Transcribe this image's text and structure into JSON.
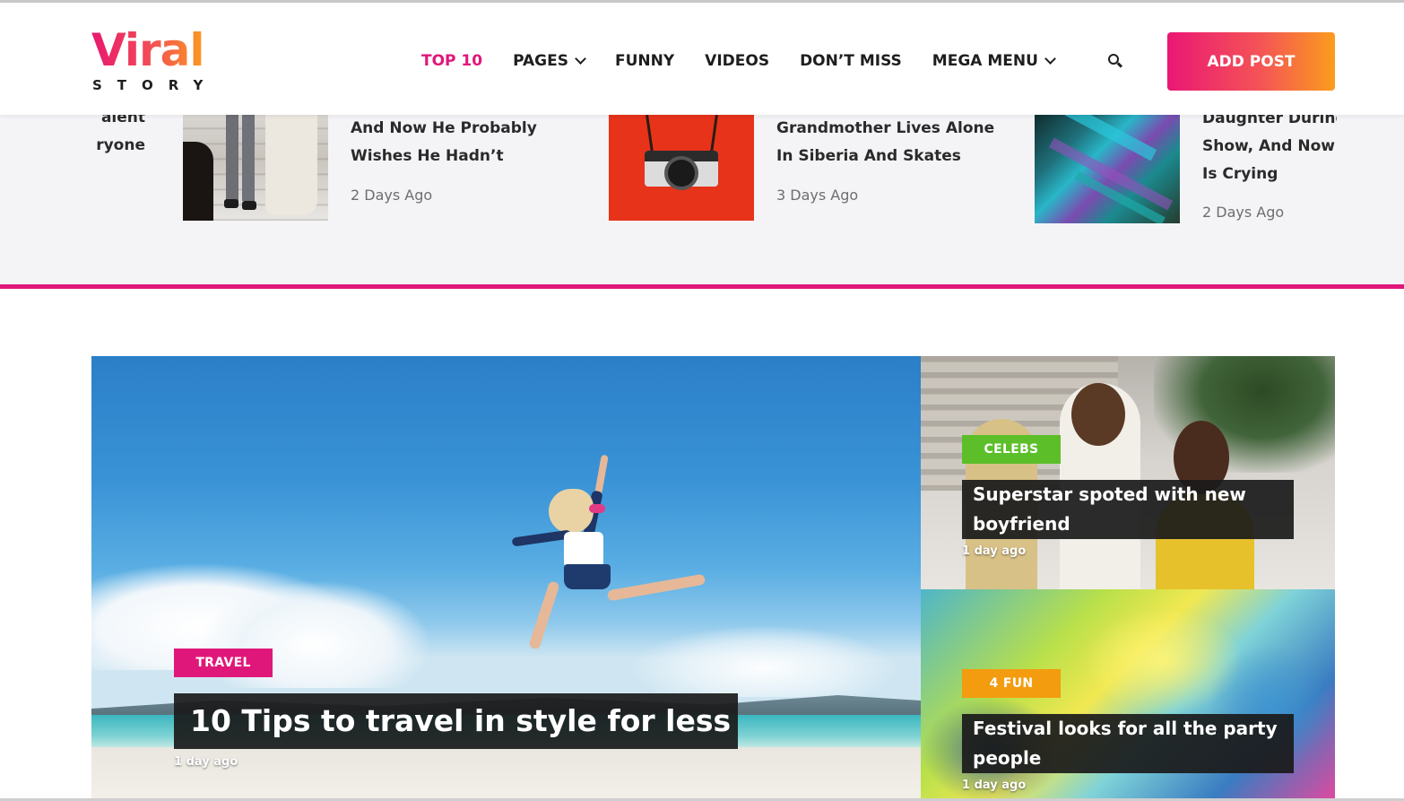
{
  "brand": {
    "logo_main": "Viral",
    "logo_sub": "STORY",
    "gradient_start": "#e8196f",
    "gradient_end": "#fb9a1f"
  },
  "nav": {
    "items": [
      {
        "label": "TOP 10",
        "active": true,
        "dropdown": false
      },
      {
        "label": "PAGES",
        "active": false,
        "dropdown": true
      },
      {
        "label": "FUNNY",
        "active": false,
        "dropdown": false
      },
      {
        "label": "VIDEOS",
        "active": false,
        "dropdown": false
      },
      {
        "label": "DON’T MISS",
        "active": false,
        "dropdown": false
      },
      {
        "label": "MEGA MENU",
        "active": false,
        "dropdown": true
      }
    ],
    "search_icon": "search-icon",
    "add_post_label": "ADD POST",
    "active_color": "#e0177a"
  },
  "trending": {
    "partial": {
      "line1": "alent",
      "line2": "ryone"
    },
    "items": [
      {
        "line1": "And Now He Probably",
        "line2": "Wishes He Hadn’t",
        "time": "2 Days Ago"
      },
      {
        "line1": "Grandmother Lives Alone",
        "line2": "In Siberia And Skates",
        "time": "3 Days Ago"
      },
      {
        "line0": "Daughter During",
        "line1": "Show, And Now",
        "line2": "Is Crying",
        "time": "2 Days Ago"
      }
    ],
    "accent_bar_color": "#e0177a"
  },
  "featured": {
    "main": {
      "category": "TRAVEL",
      "title": "10 Tips to travel in style for less",
      "time": "1 day ago",
      "category_color": "#e0177a"
    },
    "side": [
      {
        "category": "CELEBS",
        "title": "Superstar spoted with new boyfriend",
        "time": "1 day ago",
        "category_color": "#5cbf2a"
      },
      {
        "category": "4 FUN",
        "title": "Festival looks for all the party people",
        "time": "1 day ago",
        "category_color": "#f39c0f"
      }
    ]
  }
}
